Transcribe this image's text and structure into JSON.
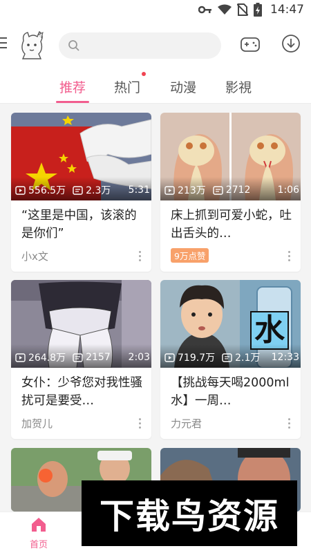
{
  "status_bar": {
    "time": "14:47"
  },
  "search": {
    "placeholder": ""
  },
  "tabs": [
    {
      "label": "推荐",
      "active": true
    },
    {
      "label": "热门",
      "active": false,
      "dot": true
    },
    {
      "label": "动漫",
      "active": false
    },
    {
      "label": "影視",
      "active": false
    }
  ],
  "cards": [
    {
      "views": "556.5万",
      "danmaku": "2.3万",
      "duration": "5:31",
      "title": "“这里是中国，该滚的是你们”",
      "author": "小x文"
    },
    {
      "views": "213万",
      "danmaku": "2712",
      "duration": "1:06",
      "title": "床上抓到可爱小蛇，吐出舌头的…",
      "badge": "9万点赞"
    },
    {
      "views": "264.8万",
      "danmaku": "2157",
      "duration": "2:03",
      "title": "女仆：少爷您对我性骚扰可是要受…",
      "author": "加贺儿"
    },
    {
      "views": "719.7万",
      "danmaku": "2.1万",
      "duration": "12:33",
      "title": "【挑战每天喝2000ml水】一周…",
      "author": "力元君",
      "thumb_text": "水"
    }
  ],
  "bottom_nav": [
    {
      "label": "首页",
      "active": true
    }
  ],
  "watermark": {
    "text": "下载鸟资源"
  },
  "colors": {
    "accent": "#f25d8e",
    "badge": "#f8a16a"
  }
}
